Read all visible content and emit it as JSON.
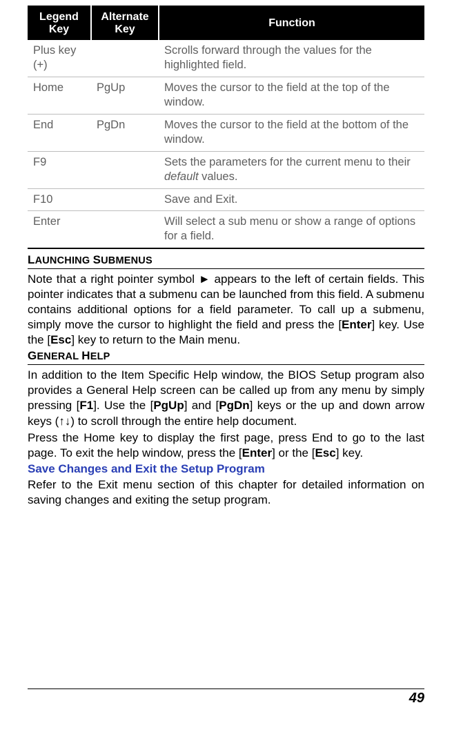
{
  "table": {
    "headers": {
      "legend": "Legend Key",
      "alternate": "Alternate Key",
      "function": "Function"
    },
    "rows": [
      {
        "legend": "Plus key (+)",
        "alternate": "",
        "function": "Scrolls forward through the values for the highlighted field."
      },
      {
        "legend": "Home",
        "alternate": "PgUp",
        "function": "Moves the cursor to the field at the top of the window."
      },
      {
        "legend": "End",
        "alternate": "PgDn",
        "function": "Moves the cursor to the field at the bottom of the window."
      },
      {
        "legend": "F9",
        "alternate": "",
        "function_prefix": "Sets the parameters for the current menu to their ",
        "function_italic": "default",
        "function_suffix": " values."
      },
      {
        "legend": "F10",
        "alternate": "",
        "function": "Save and Exit."
      },
      {
        "legend": "Enter",
        "alternate": "",
        "function": "Will select a sub menu or show a range of options for a field."
      }
    ]
  },
  "section1": {
    "title_caps1": "L",
    "title_small1": "AUNCHING ",
    "title_caps2": "S",
    "title_small2": "UBMENUS",
    "p1a": "Note that a right pointer symbol ► appears to the left of certain fields. This pointer indicates that a submenu can be launched from this field. A submenu contains additional options for a field parameter. To call up a submenu, simply move the cursor to highlight the field and press the [",
    "p1b": "Enter",
    "p1c": "] key. Use the [",
    "p1d": "Esc",
    "p1e": "] key to return to the Main menu."
  },
  "section2": {
    "title_caps1": "G",
    "title_small1": "ENERAL ",
    "title_caps2": "H",
    "title_small2": "ELP",
    "p1a": "In addition to the Item Specific Help window, the BIOS Setup program also provides a General Help screen can be called up from any menu by simply pressing [",
    "p1b": "F1",
    "p1c": "]. Use the [",
    "p1d": "PgUp",
    "p1e": "] and [",
    "p1f": "PgDn",
    "p1g": "] keys or the up and down arrow keys (↑↓) to scroll through the entire help document.",
    "p2a": "Press the Home key to display the first page, press End to go to the last page. To exit the help window, press the [",
    "p2b": "Enter",
    "p2c": "] or the [",
    "p2d": "Esc",
    "p2e": "] key."
  },
  "section3": {
    "heading": "Save Changes and Exit the Setup Program",
    "p": "Refer to the Exit menu section of this chapter for detailed information on saving changes and exiting the setup program."
  },
  "page": "49"
}
